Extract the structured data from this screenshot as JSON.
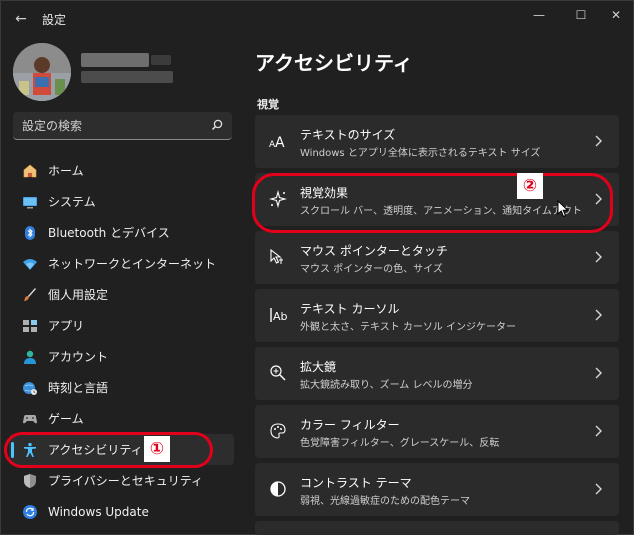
{
  "window": {
    "title": "設定",
    "back_glyph": "←",
    "minimize_glyph": "—",
    "maximize_glyph": "☐",
    "close_glyph": "✕"
  },
  "search": {
    "placeholder": "設定の検索"
  },
  "sidebar": {
    "items": [
      {
        "label": "ホーム",
        "icon": "home-icon",
        "active": false
      },
      {
        "label": "システム",
        "icon": "monitor-icon",
        "active": false
      },
      {
        "label": "Bluetooth とデバイス",
        "icon": "bluetooth-icon",
        "active": false
      },
      {
        "label": "ネットワークとインターネット",
        "icon": "wifi-icon",
        "active": false
      },
      {
        "label": "個人用設定",
        "icon": "brush-icon",
        "active": false
      },
      {
        "label": "アプリ",
        "icon": "apps-icon",
        "active": false
      },
      {
        "label": "アカウント",
        "icon": "person-icon",
        "active": false
      },
      {
        "label": "時刻と言語",
        "icon": "globe-clock-icon",
        "active": false
      },
      {
        "label": "ゲーム",
        "icon": "gamepad-icon",
        "active": false
      },
      {
        "label": "アクセシビリティ",
        "icon": "accessibility-icon",
        "active": true
      },
      {
        "label": "プライバシーとセキュリティ",
        "icon": "shield-icon",
        "active": false
      },
      {
        "label": "Windows Update",
        "icon": "update-icon",
        "active": false
      }
    ]
  },
  "main": {
    "title": "アクセシビリティ",
    "section": "視覚",
    "cards": [
      {
        "title": "テキストのサイズ",
        "subtitle": "Windows とアプリ全体に表示されるテキスト サイズ",
        "icon": "text-size-icon"
      },
      {
        "title": "視覚効果",
        "subtitle": "スクロール バー、透明度、アニメーション、通知タイムアウト",
        "icon": "sparkle-icon"
      },
      {
        "title": "マウス ポインターとタッチ",
        "subtitle": "マウス ポインターの色、サイズ",
        "icon": "pointer-icon"
      },
      {
        "title": "テキスト カーソル",
        "subtitle": "外観と太さ、テキスト カーソル インジケーター",
        "icon": "text-cursor-icon"
      },
      {
        "title": "拡大鏡",
        "subtitle": "拡大鏡読み取り、ズーム レベルの増分",
        "icon": "magnifier-icon"
      },
      {
        "title": "カラー フィルター",
        "subtitle": "色覚障害フィルター、グレースケール、反転",
        "icon": "palette-icon"
      },
      {
        "title": "コントラスト テーマ",
        "subtitle": "弱視、光線過敏症のための配色テーマ",
        "icon": "contrast-icon"
      }
    ]
  },
  "annotations": {
    "badge_1": "①",
    "badge_2": "②",
    "color": "#e3001b"
  },
  "colors": {
    "background": "#202020",
    "card": "#2b2b2b",
    "accent": "#4cc2ff"
  }
}
